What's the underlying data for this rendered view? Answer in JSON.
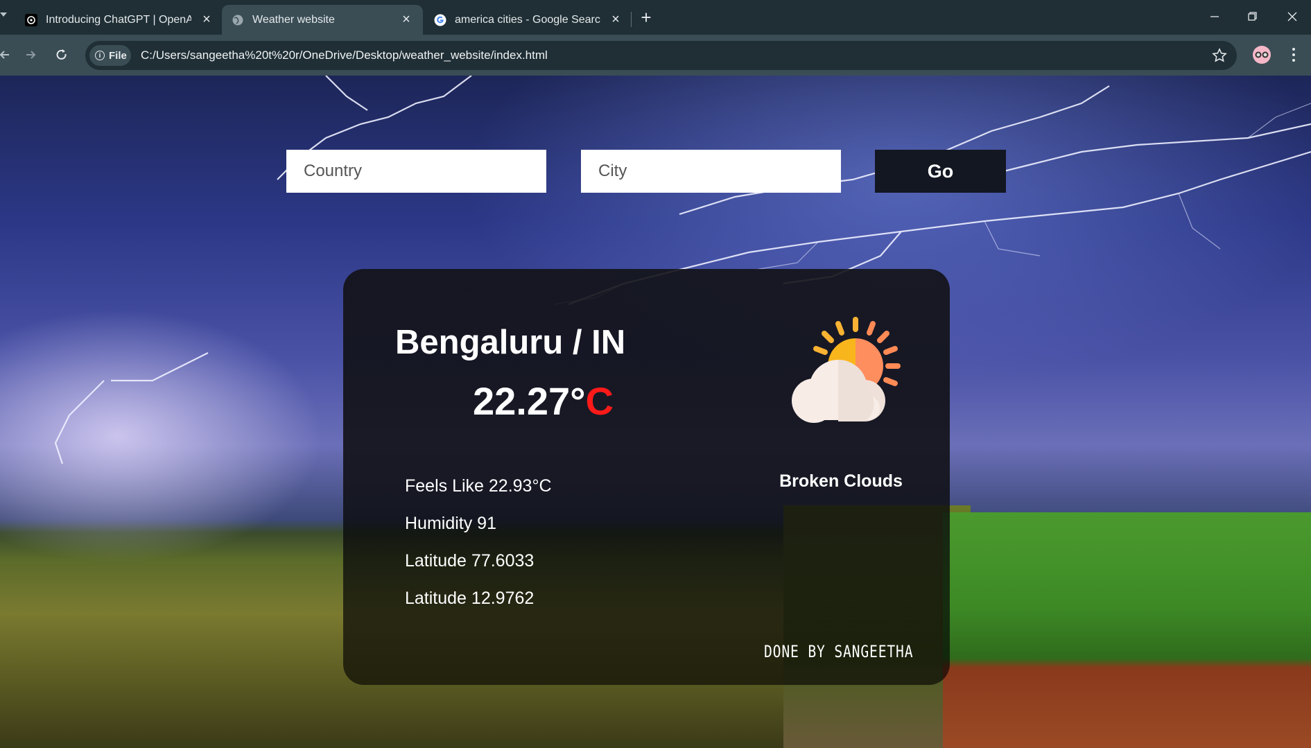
{
  "browser": {
    "tabs": [
      {
        "title": "Introducing ChatGPT | OpenAI",
        "favicon": "openai-icon",
        "active": false
      },
      {
        "title": "Weather website",
        "favicon": "globe-icon",
        "active": true
      },
      {
        "title": "america cities - Google Search",
        "favicon": "google-icon",
        "active": false
      }
    ],
    "address_chip": "File",
    "url": "C:/Users/sangeetha%20t%20r/OneDrive/Desktop/weather_website/index.html",
    "colors": {
      "tabbar": "#1f2f35",
      "toolbar": "#3a4d55"
    }
  },
  "search": {
    "country_placeholder": "Country",
    "city_placeholder": "City",
    "go_label": "Go"
  },
  "weather": {
    "location": "Bengaluru / IN",
    "temperature": "22.27°",
    "temperature_unit": "C",
    "condition": "Broken Clouds",
    "icon": "sun-behind-cloud-icon",
    "stats": [
      {
        "text": "Feels Like 22.93°C"
      },
      {
        "text": "Humidity 91"
      },
      {
        "text": "Latitude 77.6033"
      },
      {
        "text": "Latitude 12.9762"
      }
    ],
    "credit": "DONE BY SANGEETHA",
    "accent_color": "#ff1a1a"
  }
}
